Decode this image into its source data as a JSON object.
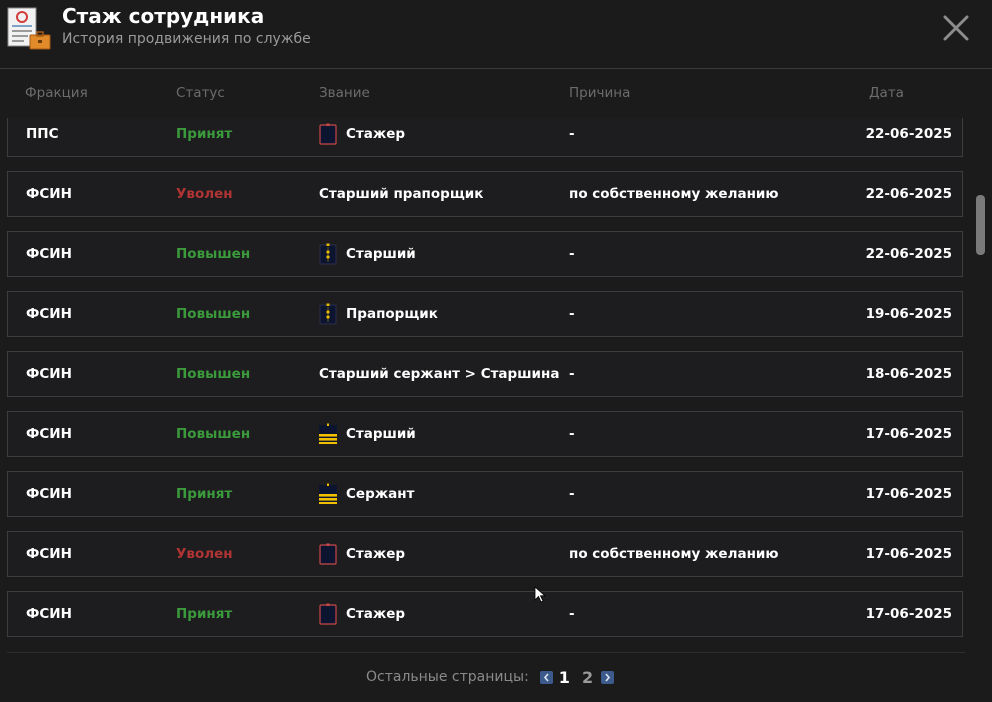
{
  "header": {
    "title": "Стаж сотрудника",
    "subtitle": "История продвижения по службе"
  },
  "columns": {
    "faction": "Фракция",
    "status": "Статус",
    "rank": "Звание",
    "reason": "Причина",
    "date": "Дата"
  },
  "rows": [
    {
      "faction": "ППС",
      "status": "Принят",
      "status_color": "#3b9a3b",
      "rank": "Стажер",
      "rank_icon": "trainee-epaulette-icon",
      "reason": "-",
      "date": "22-06-2025"
    },
    {
      "faction": "ФСИН",
      "status": "Уволен",
      "status_color": "#b13434",
      "rank": "Старший прапорщик",
      "rank_icon": "",
      "reason": "по собственному желанию",
      "date": "22-06-2025"
    },
    {
      "faction": "ФСИН",
      "status": "Повышен",
      "status_color": "#3b9a3b",
      "rank": "Старший",
      "rank_icon": "star-epaulette-icon",
      "reason": "-",
      "date": "22-06-2025"
    },
    {
      "faction": "ФСИН",
      "status": "Повышен",
      "status_color": "#3b9a3b",
      "rank": "Прапорщик",
      "rank_icon": "star-epaulette-icon",
      "reason": "-",
      "date": "19-06-2025"
    },
    {
      "faction": "ФСИН",
      "status": "Повышен",
      "status_color": "#3b9a3b",
      "rank": "Старший сержант > Старшина",
      "rank_icon": "",
      "reason": "-",
      "date": "18-06-2025"
    },
    {
      "faction": "ФСИН",
      "status": "Повышен",
      "status_color": "#3b9a3b",
      "rank": "Старший",
      "rank_icon": "stripes-epaulette-icon",
      "reason": "-",
      "date": "17-06-2025"
    },
    {
      "faction": "ФСИН",
      "status": "Принят",
      "status_color": "#3b9a3b",
      "rank": "Сержант",
      "rank_icon": "stripes-epaulette-icon",
      "reason": "-",
      "date": "17-06-2025"
    },
    {
      "faction": "ФСИН",
      "status": "Уволен",
      "status_color": "#b13434",
      "rank": "Стажер",
      "rank_icon": "trainee-epaulette-icon",
      "reason": "по собственному желанию",
      "date": "17-06-2025"
    },
    {
      "faction": "ФСИН",
      "status": "Принят",
      "status_color": "#3b9a3b",
      "rank": "Стажер",
      "rank_icon": "trainee-epaulette-icon",
      "reason": "-",
      "date": "17-06-2025"
    }
  ],
  "pagination": {
    "label": "Остальные страницы:",
    "current": "1",
    "next": "2"
  }
}
